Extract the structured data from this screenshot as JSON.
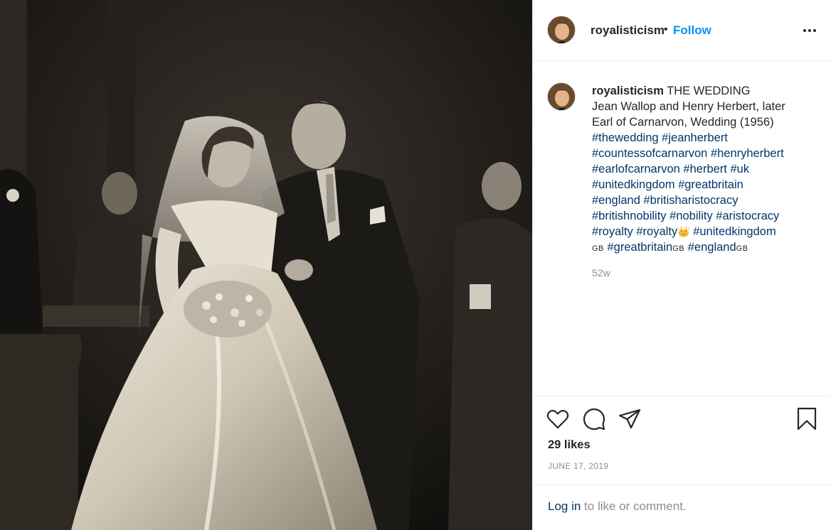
{
  "post": {
    "username": "royalisticism",
    "follow_label": "Follow",
    "separator": "•",
    "caption_title": "THE WEDDING",
    "caption_lines": [
      "Jean Wallop and Henry Herbert, later",
      "Earl of Carnarvon, Wedding (1956)"
    ],
    "hashtags": {
      "thewedding": "#thewedding",
      "jeanherbert": "#jeanherbert",
      "countessofcarnarvon": "#countessofcarnarvon",
      "henryherbert": "#henryherbert",
      "earlofcarnarvon": "#earlofcarnarvon",
      "herbert": "#herbert",
      "uk": "#uk",
      "unitedkingdom": "#unitedkingdom",
      "greatbritain": "#greatbritain",
      "england": "#england",
      "britisharistocracy": "#britisharistocracy",
      "britishnobility": "#britishnobility",
      "nobility": "#nobility",
      "aristocracy": "#aristocracy",
      "royalty": "#royalty",
      "royalty_crown": "#royalty",
      "unitedkingdom_flag": "#unitedkingdom",
      "greatbritain_flag": "#greatbritain",
      "england_flag": "#england"
    },
    "flag_text": "GB",
    "crown_emoji": "👑",
    "time_ago": "52w",
    "likes": "29 likes",
    "date": "JUNE 17, 2019",
    "login_link": "Log in",
    "login_suffix": " to like or comment."
  },
  "icons": {
    "more": "more-options-icon",
    "like": "heart-icon",
    "comment": "comment-icon",
    "share": "paper-plane-icon",
    "save": "bookmark-icon"
  },
  "colors": {
    "link": "#00376b",
    "follow": "#0095f6",
    "muted": "#8e8e8e",
    "text": "#262626",
    "border": "#efefef"
  }
}
